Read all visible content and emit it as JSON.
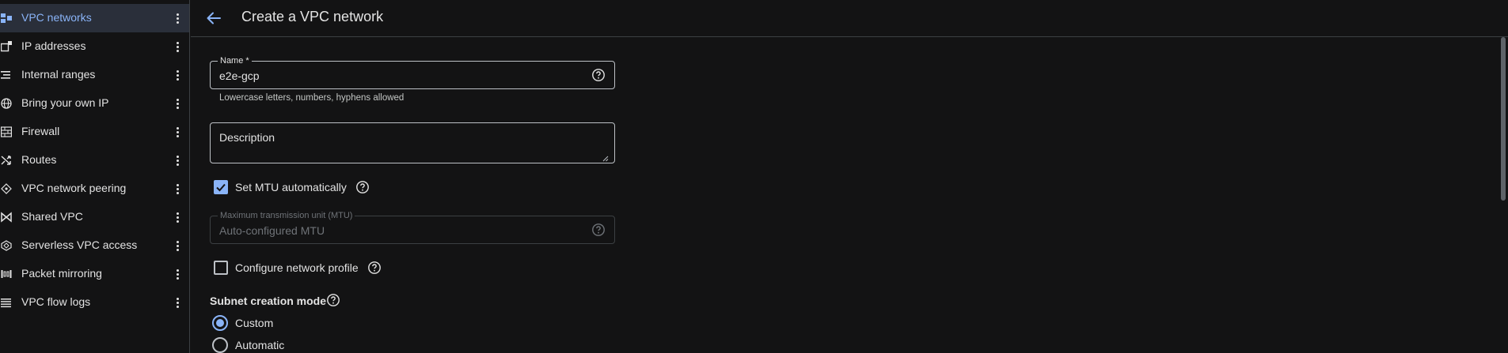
{
  "header": {
    "title": "Create a VPC network"
  },
  "sidebar": {
    "items": [
      {
        "label": "VPC networks",
        "icon": "vpc-network-icon"
      },
      {
        "label": "IP addresses",
        "icon": "ip-address-icon"
      },
      {
        "label": "Internal ranges",
        "icon": "internal-ranges-icon"
      },
      {
        "label": "Bring your own IP",
        "icon": "globe-icon"
      },
      {
        "label": "Firewall",
        "icon": "firewall-icon"
      },
      {
        "label": "Routes",
        "icon": "routes-icon"
      },
      {
        "label": "VPC network peering",
        "icon": "peering-icon"
      },
      {
        "label": "Shared VPC",
        "icon": "shared-vpc-icon"
      },
      {
        "label": "Serverless VPC access",
        "icon": "serverless-icon"
      },
      {
        "label": "Packet mirroring",
        "icon": "packet-mirroring-icon"
      },
      {
        "label": "VPC flow logs",
        "icon": "flow-logs-icon"
      }
    ],
    "active_index": 0
  },
  "form": {
    "name": {
      "label": "Name *",
      "value": "e2e-gcp",
      "hint": "Lowercase letters, numbers, hyphens allowed"
    },
    "description": {
      "placeholder": "Description"
    },
    "set_mtu": {
      "label": "Set MTU automatically",
      "checked": true
    },
    "mtu": {
      "label": "Maximum transmission unit (MTU)",
      "value": "Auto-configured MTU"
    },
    "network_profile": {
      "label": "Configure network profile",
      "checked": false
    },
    "subnet_mode": {
      "title": "Subnet creation mode",
      "options": [
        {
          "label": "Custom",
          "selected": true
        },
        {
          "label": "Automatic",
          "selected": false
        }
      ]
    }
  },
  "colors": {
    "accent": "#8ab4f8",
    "background": "#131314",
    "border": "#bdc1c6",
    "active_nav_bg": "#2a2f3a"
  }
}
